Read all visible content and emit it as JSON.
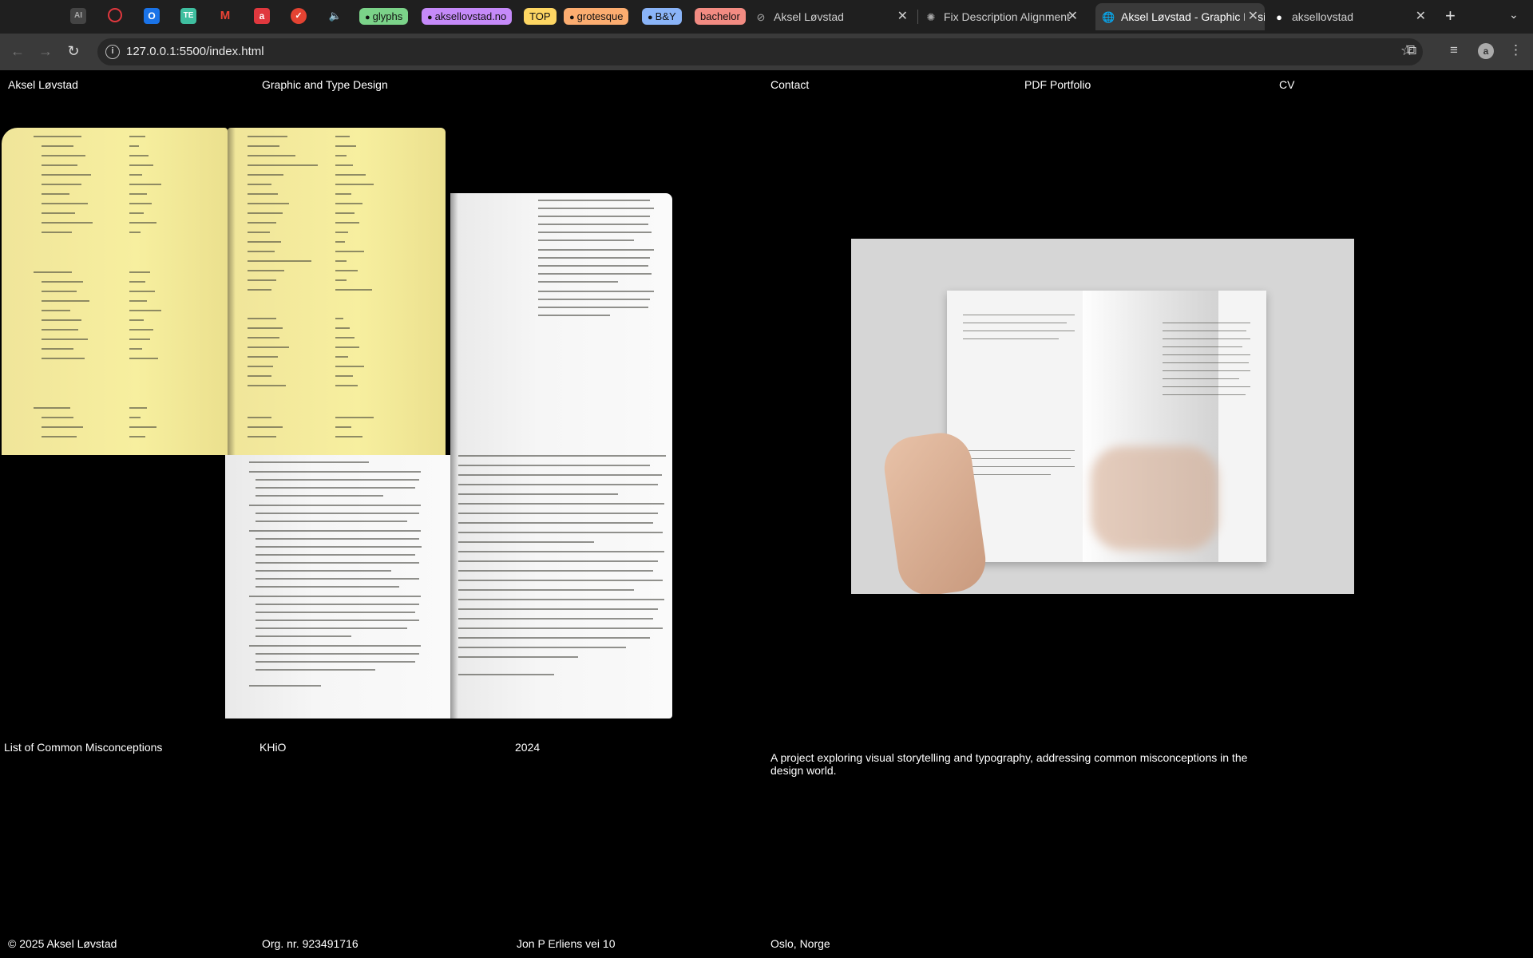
{
  "browser": {
    "pinned": [
      {
        "icon": "ai-icon",
        "glyph": "AI",
        "color": "#555555"
      },
      {
        "icon": "opera-icon",
        "glyph": "◯",
        "color": "#e0383e"
      },
      {
        "icon": "outlook-icon",
        "glyph": "O",
        "color": "#1a73e8"
      },
      {
        "icon": "te-icon",
        "glyph": "TE",
        "color": "#3fbfa0"
      },
      {
        "icon": "gmail-icon",
        "glyph": "M",
        "color": "#2b2b2b"
      },
      {
        "icon": "app-icon",
        "glyph": "a",
        "color": "#e0383e"
      },
      {
        "icon": "todoist-icon",
        "glyph": "✓",
        "color": "#e44332"
      },
      {
        "icon": "audio-icon",
        "glyph": "🔈",
        "color": "#1f1f1f"
      }
    ],
    "groups": [
      {
        "label": "glyphs",
        "color": "#7bd389"
      },
      {
        "label": "aksellovstad.no",
        "color": "#c58af9"
      },
      {
        "label": "TOP",
        "color": "#fdd663"
      },
      {
        "label": "grotesque",
        "color": "#fcad70"
      },
      {
        "label": "B&Y",
        "color": "#8ab4f8"
      },
      {
        "label": "bachelor",
        "color": "#f28b82"
      }
    ],
    "tabs": [
      {
        "title": "Aksel Løvstad",
        "active": false
      },
      {
        "title": "Fix Description Alignment",
        "active": false
      },
      {
        "title": "Aksel Løvstad - Graphic Design",
        "active": true
      },
      {
        "title": "aksellovstad",
        "active": false
      }
    ],
    "url": "127.0.0.1:5500/index.html"
  },
  "header": {
    "name": "Aksel Løvstad",
    "tagline": "Graphic and Type Design",
    "contact": "Contact",
    "portfolio": "PDF Portfolio",
    "cv": "CV"
  },
  "project": {
    "title": "List of Common Misconceptions",
    "school": "KHiO",
    "year": "2024",
    "description": "A project exploring visual storytelling and typography, addressing common misconceptions in the design world."
  },
  "footer": {
    "copyright": "© 2025 Aksel Løvstad",
    "org": "Org. nr. 923491716",
    "address": "Jon P Erliens vei 10",
    "city": "Oslo, Norge"
  }
}
